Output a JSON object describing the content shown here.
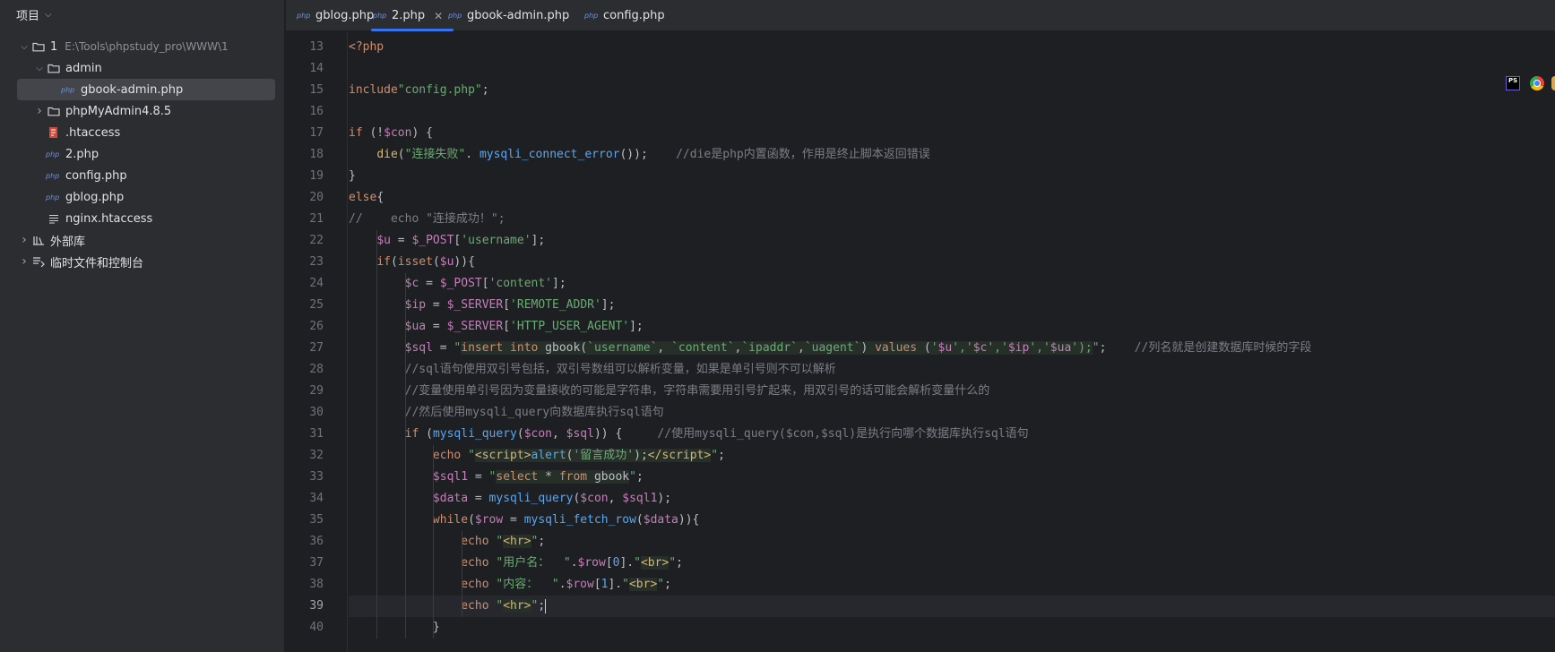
{
  "sidebar": {
    "title": "项目",
    "tree": [
      {
        "label": "1",
        "path": "E:\\Tools\\phpstudy_pro\\WWW\\1",
        "type": "folder",
        "depth": 0,
        "expanded": true
      },
      {
        "label": "admin",
        "type": "folder",
        "depth": 1,
        "expanded": true
      },
      {
        "label": "gbook-admin.php",
        "type": "php",
        "depth": 2,
        "selected": true
      },
      {
        "label": "phpMyAdmin4.8.5",
        "type": "folder",
        "depth": 1,
        "expanded": false
      },
      {
        "label": ".htaccess",
        "type": "htaccess",
        "depth": 1
      },
      {
        "label": "2.php",
        "type": "php",
        "depth": 1
      },
      {
        "label": "config.php",
        "type": "php",
        "depth": 1
      },
      {
        "label": "gblog.php",
        "type": "php",
        "depth": 1
      },
      {
        "label": "nginx.htaccess",
        "type": "text",
        "depth": 1
      },
      {
        "label": "外部库",
        "type": "library",
        "depth": 0,
        "expanded": false
      },
      {
        "label": "临时文件和控制台",
        "type": "scratch",
        "depth": 0,
        "expanded": false
      }
    ]
  },
  "tabs": [
    {
      "label": "gblog.php",
      "icon": "php"
    },
    {
      "label": "2.php",
      "icon": "php",
      "active": true,
      "close": "✕"
    },
    {
      "label": "gbook-admin.php",
      "icon": "php"
    },
    {
      "label": "config.php",
      "icon": "php"
    }
  ],
  "editor": {
    "current_line": 39,
    "lines": [
      {
        "n": "13",
        "html": "<span class='k'>&lt;?php</span>"
      },
      {
        "n": "14",
        "html": ""
      },
      {
        "n": "15",
        "html": "<span class='k'>include</span><span class='s'>\"config.php\"</span>;"
      },
      {
        "n": "16",
        "html": ""
      },
      {
        "n": "17",
        "html": "<span class='k'>if</span> (!<span class='v'>$con</span>) {"
      },
      {
        "n": "18",
        "html": "    <span class='t'>die</span>(<span class='s'>\"连接失败\"</span>. <span class='f'>mysqli_connect_error</span>());    <span class='c'>//die是php内置函数，作用是终止脚本返回错误</span>"
      },
      {
        "n": "19",
        "html": "}"
      },
      {
        "n": "20",
        "html": "<span class='k'>else</span>{"
      },
      {
        "n": "21",
        "html": "<span class='c'>//    echo \"连接成功！\";</span>"
      },
      {
        "n": "22",
        "html": "    <span class='v'>$u</span> = <span class='v'>$_POST</span>[<span class='s'>'username'</span>];"
      },
      {
        "n": "23",
        "html": "    <span class='k'>if</span>(<span class='k'>isset</span>(<span class='v'>$u</span>)){"
      },
      {
        "n": "24",
        "html": "        <span class='v'>$c</span> = <span class='v'>$_POST</span>[<span class='s'>'content'</span>];"
      },
      {
        "n": "25",
        "html": "        <span class='v'>$ip</span> = <span class='v'>$_SERVER</span>[<span class='s'>'REMOTE_ADDR'</span>];"
      },
      {
        "n": "26",
        "html": "        <span class='v'>$ua</span> = <span class='v'>$_SERVER</span>[<span class='s'>'HTTP_USER_AGENT'</span>];"
      },
      {
        "n": "27",
        "html": "        <span class='v'>$sql</span> = <span class='s'>\"</span><span class='sqlbg'><span class='k'>insert into</span> gbook(<span class='s'>`username`</span>, <span class='s'>`content`</span>,<span class='s'>`ipaddr`</span>,<span class='s'>`uagent`</span>) <span class='k'>values</span> (<span class='s'>'</span><span class='v'>$u</span><span class='s'>','</span><span class='v'>$c</span><span class='s'>','</span><span class='v'>$ip</span><span class='s'>','</span><span class='v'>$ua</span><span class='s'>');</span></span><span class='s'>\"</span>;    <span class='c'>//列名就是创建数据库时候的字段</span>"
      },
      {
        "n": "28",
        "html": "        <span class='c'>//sql语句使用双引号包括，双引号数组可以解析变量，如果是单引号则不可以解析</span>"
      },
      {
        "n": "29",
        "html": "        <span class='c'>//变量使用单引号因为变量接收的可能是字符串，字符串需要用引号扩起来，用双引号的话可能会解析变量什么的</span>"
      },
      {
        "n": "30",
        "html": "        <span class='c'>//然后使用mysqli_query向数据库执行sql语句</span>"
      },
      {
        "n": "31",
        "html": "        <span class='k'>if</span> (<span class='f'>mysqli_query</span>(<span class='v'>$con</span>, <span class='v'>$sql</span>)) {     <span class='c'>//使用mysqli_query($con,$sql)是执行向哪个数据库执行sql语句</span>"
      },
      {
        "n": "32",
        "html": "            <span class='k'>echo</span> <span class='s'>\"</span><span class='sqlbg'><span class='t'>&lt;script&gt;</span><span class='f'>alert</span>(<span class='s'>'留言成功'</span>);<span class='t'>&lt;/script&gt;</span></span><span class='s'>\"</span>;"
      },
      {
        "n": "33",
        "html": "            <span class='v'>$sql1</span> = <span class='s'>\"</span><span class='sqlbg'><span class='k'>select</span> * <span class='k'>from</span> gbook</span><span class='s'>\"</span>;"
      },
      {
        "n": "34",
        "html": "            <span class='v'>$data</span> = <span class='f'>mysqli_query</span>(<span class='v'>$con</span>, <span class='v'>$sql1</span>);"
      },
      {
        "n": "35",
        "html": "            <span class='k'>while</span>(<span class='v'>$row</span> = <span class='f'>mysqli_fetch_row</span>(<span class='v'>$data</span>)){"
      },
      {
        "n": "36",
        "html": "                <span class='k'>echo</span> <span class='s'>\"</span><span class='t sqlbg'>&lt;hr&gt;</span><span class='s'>\"</span>;"
      },
      {
        "n": "37",
        "html": "                <span class='k'>echo</span> <span class='s'>\"用户名：  \"</span>.<span class='v'>$row</span>[<span class='f'>0</span>].<span class='s'>\"</span><span class='t sqlbg'>&lt;br&gt;</span><span class='s'>\"</span>;"
      },
      {
        "n": "38",
        "html": "                <span class='k'>echo</span> <span class='s'>\"内容：  \"</span>.<span class='v'>$row</span>[<span class='f'>1</span>].<span class='s'>\"</span><span class='t sqlbg'>&lt;br&gt;</span><span class='s'>\"</span>;"
      },
      {
        "n": "39",
        "html": "                <span class='k'>echo</span> <span class='s'>\"</span><span class='t sqlbg'>&lt;hr&gt;</span><span class='s'>\"</span>;<span class='cursor'></span>"
      },
      {
        "n": "40",
        "html": "            }"
      }
    ]
  },
  "right_icons": {
    "ps_label": "PS"
  }
}
